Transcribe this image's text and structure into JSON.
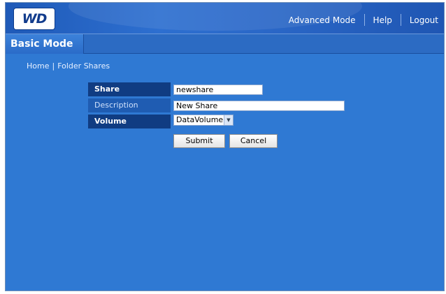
{
  "header": {
    "logo_text": "WD",
    "nav": {
      "advanced_mode": "Advanced Mode",
      "help": "Help",
      "logout": "Logout"
    }
  },
  "mode_tab": "Basic Mode",
  "breadcrumb": {
    "home": "Home",
    "separator": "|",
    "current": "Folder Shares"
  },
  "form": {
    "share_label": "Share",
    "share_value": "newshare",
    "description_label": "Description",
    "description_value": "New Share",
    "volume_label": "Volume",
    "volume_value": "DataVolume",
    "submit_label": "Submit",
    "cancel_label": "Cancel"
  },
  "colors": {
    "background": "#2f79d3",
    "label_dark": "#103c82",
    "label_light": "#1f5cb2"
  }
}
